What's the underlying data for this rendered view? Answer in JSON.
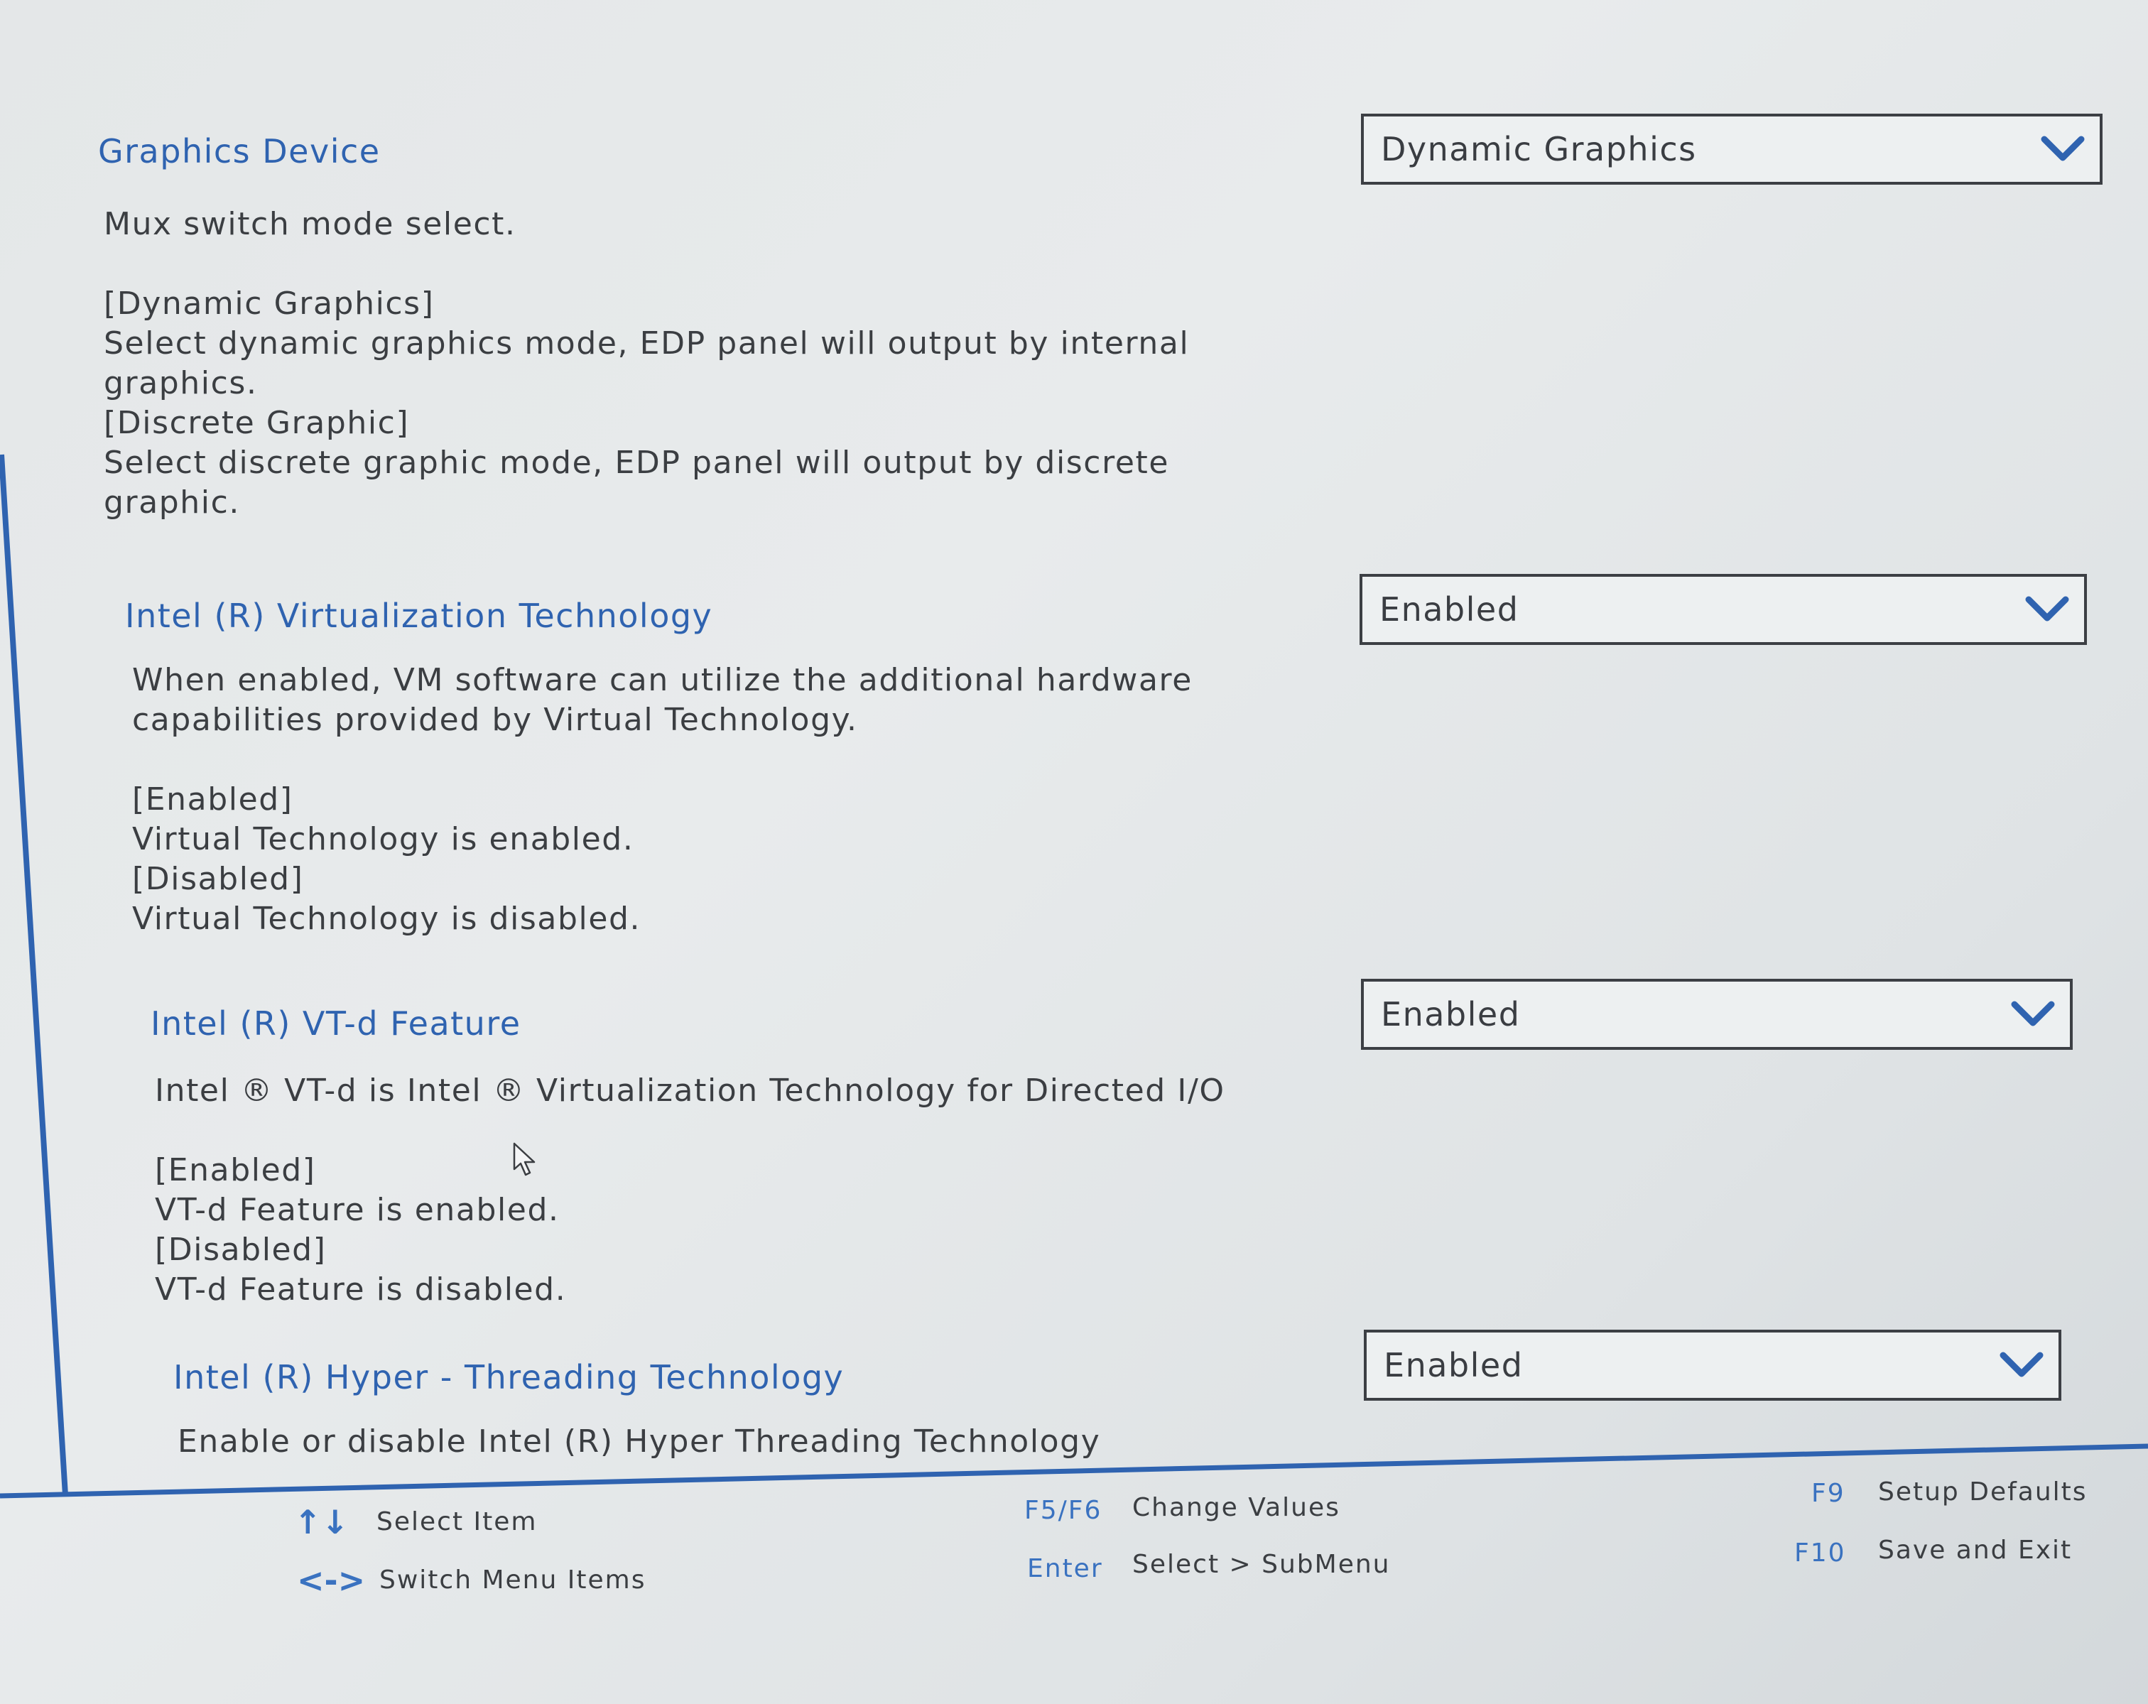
{
  "settings": [
    {
      "title": "Graphics Device",
      "value": "Dynamic Graphics",
      "help": [
        "Mux switch mode select.",
        "",
        "[Dynamic Graphics]",
        "Select dynamic graphics mode, EDP panel will output by internal",
        "graphics.",
        "[Discrete Graphic]",
        "Select discrete graphic mode, EDP panel will output by discrete",
        "graphic."
      ]
    },
    {
      "title": "Intel (R) Virtualization Technology",
      "value": "Enabled",
      "help": [
        "When enabled, VM software can utilize the additional hardware",
        "capabilities provided by Virtual Technology.",
        "",
        "[Enabled]",
        "Virtual Technology is enabled.",
        "[Disabled]",
        "Virtual Technology is disabled."
      ]
    },
    {
      "title": "Intel (R) VT-d Feature",
      "value": "Enabled",
      "help": [
        "Intel ® VT-d is Intel ® Virtualization Technology for Directed I/O",
        "",
        "[Enabled]",
        "VT-d Feature is enabled.",
        "[Disabled]",
        "VT-d Feature is disabled."
      ]
    },
    {
      "title": "Intel (R) Hyper - Threading Technology",
      "value": "Enabled",
      "help": [
        "Enable or disable Intel (R) Hyper Threading Technology"
      ]
    }
  ],
  "footer": {
    "select_item": {
      "icon": "↑↓",
      "label": "Select Item"
    },
    "switch_menu": {
      "icon": "<->",
      "label": "Switch Menu Items"
    },
    "change_values": {
      "key": "F5/F6",
      "label": "Change Values"
    },
    "select_submenu": {
      "key": "Enter",
      "label": "Select > SubMenu"
    },
    "setup_defaults": {
      "key": "F9",
      "label": "Setup Defaults"
    },
    "save_exit": {
      "key": "F10",
      "label": "Save and Exit"
    }
  },
  "colors": {
    "accent": "#2f63b0",
    "text": "#3b3e42",
    "background": "#e6e9ea"
  }
}
